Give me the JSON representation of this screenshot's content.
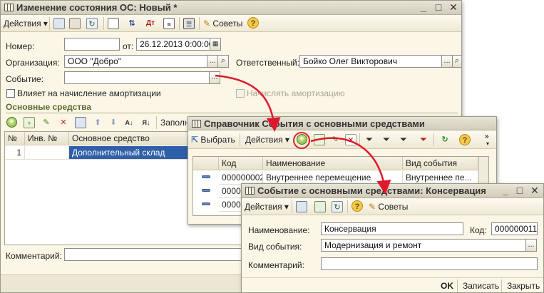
{
  "main_window": {
    "title": "Изменение состояния ОС: Новый *",
    "toolbar": {
      "actions": "Действия",
      "advice": "Советы"
    },
    "number_label": "Номер:",
    "number_value": "",
    "date_label": "от:",
    "date_value": "26.12.2013  0:00:00",
    "org_label": "Организация:",
    "org_value": "ООО \"Добро\"",
    "responsible_label": "Ответственный:",
    "responsible_value": "Бойко Олег Викторович",
    "event_label": "Событие:",
    "event_value": "",
    "depreciation_checkbox": "Влияет на начисление амортизации",
    "accrue_checkbox": "Начислять амортизацию",
    "section_title": "Основные средства",
    "fill_button": "Заполнить",
    "table_headers": [
      "№",
      "Инв. №",
      "Основное средство"
    ],
    "table_rows": [
      {
        "n": "1",
        "inv": "",
        "asset": "Дополнительный склад"
      }
    ],
    "comment_label": "Комментарий:",
    "comment_value": ""
  },
  "catalog_window": {
    "title": "Справочник События с основными средствами",
    "toolbar": {
      "select": "Выбрать",
      "actions": "Действия"
    },
    "headers": [
      "Код",
      "Наименование",
      "Вид события"
    ],
    "rows": [
      {
        "code": "000000002",
        "name": "Внутреннее перемещение",
        "type": "Внутреннее пе..."
      },
      {
        "code": "0000",
        "name": "",
        "type": ""
      },
      {
        "code": "0000",
        "name": "",
        "type": ""
      }
    ]
  },
  "event_window": {
    "title": "Событие с основными средствами: Консервация",
    "toolbar": {
      "actions": "Действия",
      "advice": "Советы"
    },
    "name_label": "Наименование:",
    "name_value": "Консервация",
    "code_label": "Код:",
    "code_value": "000000011",
    "type_label": "Вид события:",
    "type_value": "Модернизация и ремонт",
    "comment_label": "Комментарий:",
    "comment_value": "",
    "buttons": {
      "ok": "OK",
      "save": "Записать",
      "close": "Закрыть"
    }
  },
  "colors": {
    "window_bg": "#fbf6e6",
    "selected_row": "#2f5fa8",
    "arrow_red": "#e0182c",
    "section_title": "#5d6b2f"
  }
}
